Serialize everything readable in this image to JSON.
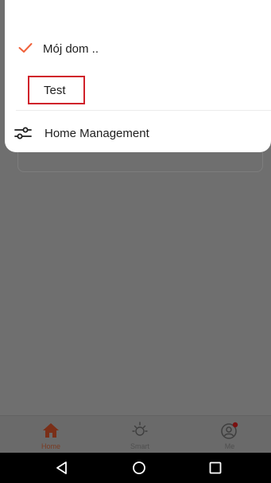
{
  "menu": {
    "items": [
      {
        "label": "Mój dom ..",
        "selected": true
      },
      {
        "label": "Test",
        "selected": false,
        "highlighted": true
      }
    ],
    "management_label": "Home Management"
  },
  "tabbar": {
    "tabs": [
      {
        "label": "Home",
        "icon": "home-icon",
        "active": true
      },
      {
        "label": "Smart",
        "icon": "sun-icon",
        "active": false
      },
      {
        "label": "Me",
        "icon": "profile-icon",
        "active": false,
        "badge": true
      }
    ]
  },
  "colors": {
    "accent": "#f0613a",
    "highlight_border": "#d0202a",
    "overlay": "#6f6f6f"
  }
}
